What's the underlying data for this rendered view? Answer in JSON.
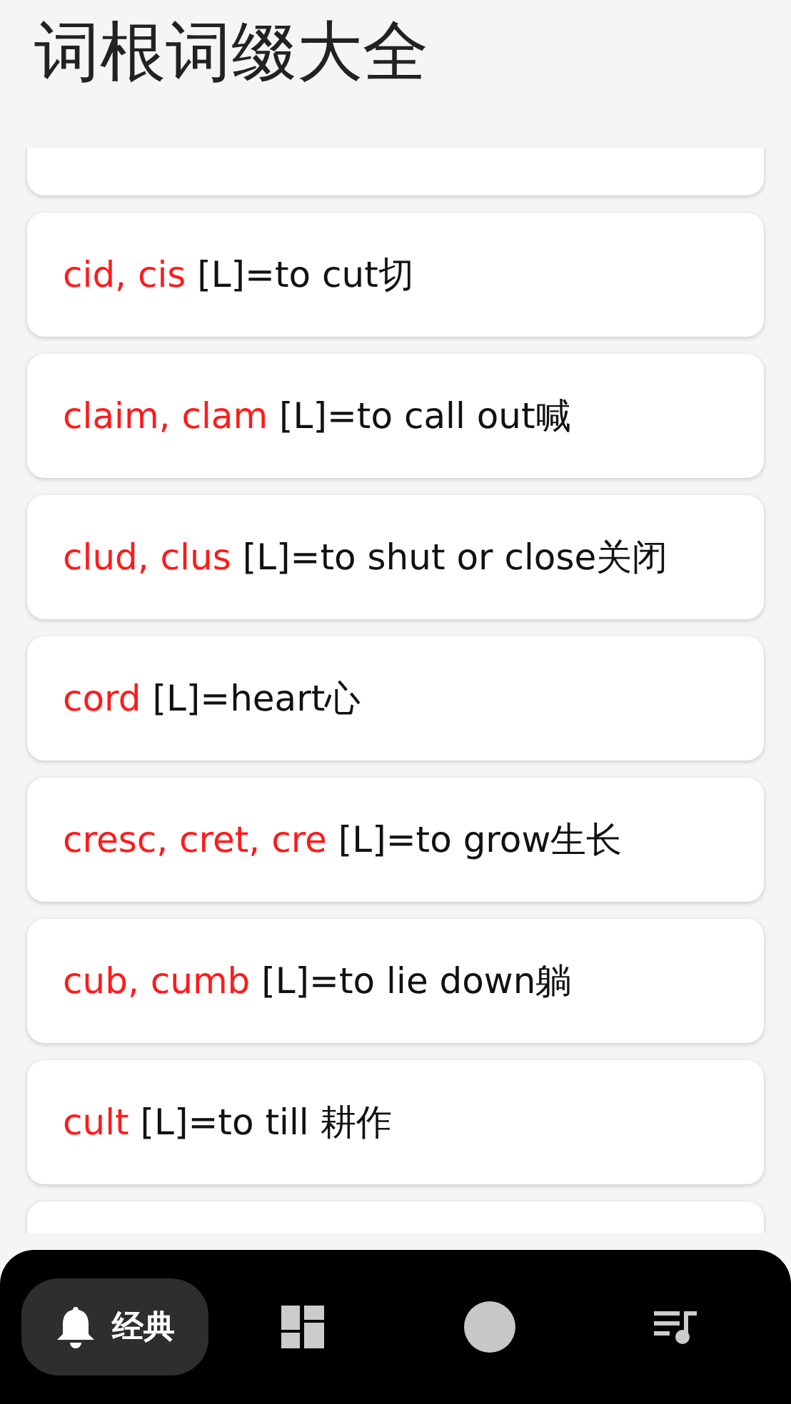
{
  "title": "词根词缀大全",
  "entries": [
    {
      "kind": "partial"
    },
    {
      "kind": "entry",
      "root": "cid, cis",
      "meaning": "[L]=to cut切"
    },
    {
      "kind": "entry",
      "root": "claim, clam",
      "meaning": "[L]=to call out喊"
    },
    {
      "kind": "entry",
      "root": "clud, clus",
      "meaning": "[L]=to shut or close关闭"
    },
    {
      "kind": "entry",
      "root": "cord",
      "meaning": "[L]=heart心"
    },
    {
      "kind": "entry",
      "root": "cresc, cret, cre",
      "meaning": "[L]=to grow生长"
    },
    {
      "kind": "entry",
      "root": "cub, cumb",
      "meaning": "[L]=to lie down躺"
    },
    {
      "kind": "entry",
      "root": "cult",
      "meaning": "[L]=to till 耕作"
    },
    {
      "kind": "partial"
    }
  ],
  "nav": [
    {
      "kind": "bell",
      "label": "经典",
      "selected": true
    },
    {
      "kind": "grid",
      "selected": false
    },
    {
      "kind": "circle",
      "selected": false
    },
    {
      "kind": "playlist",
      "selected": false
    }
  ]
}
